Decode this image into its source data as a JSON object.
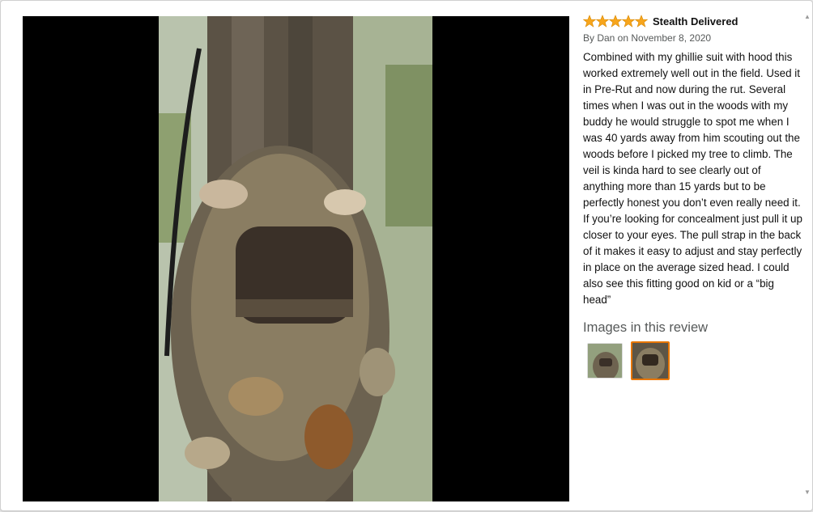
{
  "review": {
    "rating": 5,
    "title": "Stealth Delivered",
    "byline": "By Dan on November 8, 2020",
    "body": "Combined with my ghillie suit with hood this worked extremely well out in the field. Used it in Pre-Rut and now during the rut. Several times when I was out in the woods with my buddy he would struggle to spot me when I was 40 yards away from him scouting out the woods before I picked my tree to climb. The veil is kinda hard to see clearly out of anything more than 15 yards but to be perfectly honest you don’t even really need it. If you’re looking for concealment just pull it up closer to your eyes. The pull strap in the back of it makes it easy to adjust and stay perfectly in place on the average sized head. I could also see this fitting good on kid or a “big head”"
  },
  "images_section": {
    "heading": "Images in this review",
    "selected_index": 1,
    "thumbnails": [
      "camo-hood-thumb",
      "camo-hood-closeup-thumb"
    ]
  },
  "colors": {
    "star": "#f7a51c",
    "selected_border": "#e77600",
    "viewer_bg": "#000000"
  },
  "icons": {
    "star": "star-icon",
    "scroll_up": "scroll-up-arrow-icon",
    "scroll_down": "scroll-down-arrow-icon"
  }
}
